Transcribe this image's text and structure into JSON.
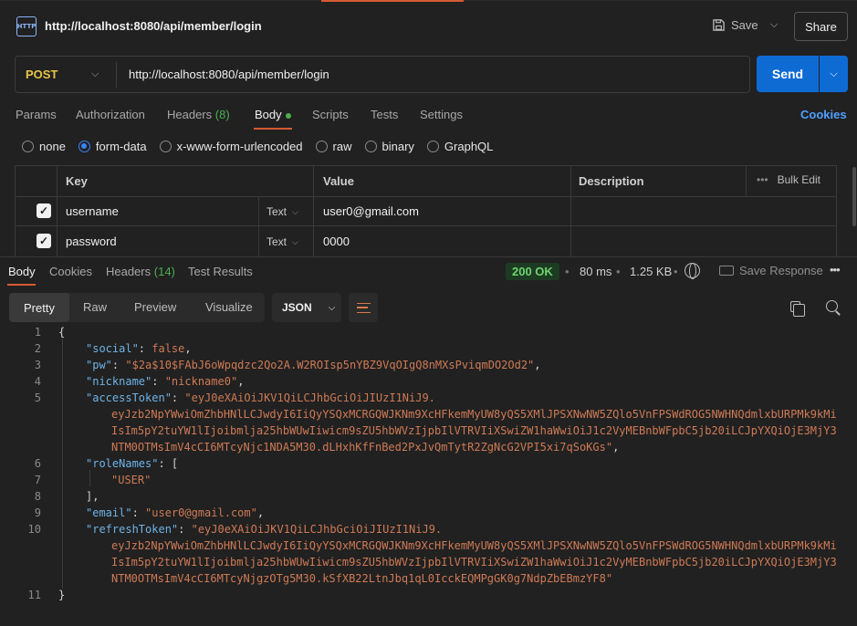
{
  "header": {
    "icon_text": "HTTP",
    "title": "http://localhost:8080/api/member/login",
    "save_label": "Save",
    "share_label": "Share"
  },
  "request": {
    "method": "POST",
    "url": "http://localhost:8080/api/member/login",
    "send_label": "Send",
    "tabs": [
      {
        "label": "Params"
      },
      {
        "label": "Authorization"
      },
      {
        "label": "Headers",
        "count": "(8)"
      },
      {
        "label": "Body"
      },
      {
        "label": "Scripts"
      },
      {
        "label": "Tests"
      },
      {
        "label": "Settings"
      }
    ],
    "cookies_label": "Cookies",
    "body_types": [
      "none",
      "form-data",
      "x-www-form-urlencoded",
      "raw",
      "binary",
      "GraphQL"
    ],
    "selected_body_type": "form-data",
    "table": {
      "headers": {
        "key": "Key",
        "value": "Value",
        "description": "Description",
        "bulk_edit": "Bulk Edit"
      },
      "rows": [
        {
          "checked": true,
          "key": "username",
          "type": "Text",
          "value": "user0@gmail.com",
          "description": ""
        },
        {
          "checked": true,
          "key": "password",
          "type": "Text",
          "value": "0000",
          "description": ""
        }
      ]
    }
  },
  "response": {
    "tabs": [
      {
        "label": "Body"
      },
      {
        "label": "Cookies"
      },
      {
        "label": "Headers",
        "count": "(14)"
      },
      {
        "label": "Test Results"
      }
    ],
    "status": "200 OK",
    "time": "80 ms",
    "size": "1.25 KB",
    "save_response_label": "Save Response",
    "views": [
      "Pretty",
      "Raw",
      "Preview",
      "Visualize"
    ],
    "format": "JSON",
    "line_numbers": [
      "1",
      "2",
      "3",
      "4",
      "5",
      "6",
      "7",
      "8",
      "9",
      "10",
      "11"
    ],
    "json": {
      "social": "false",
      "pw": "\"$2a$10$FAbJ6oWpqdzc2Qo2A.W2ROIsp5nYBZ9VqOIgQ8nMXsPviqmDO2Od2\"",
      "nickname": "\"nickname0\"",
      "accessToken_lines": [
        "\"eyJ0eXAiOiJKV1QiLCJhbGciOiJIUzI1NiJ9.",
        "eyJzb2NpYWwiOmZhbHNlLCJwdyI6IiQyYSQxMCRGQWJKNm9XcHFkemMyUW8yQS5XMlJPSXNwNW5ZQlo5VnFPSWdROG5NWHNQdmlxbURPMk9kMi",
        "IsIm5pY2tuYW1lIjoibmlja25hbWUwIiwicm9sZU5hbWVzIjpbIlVTRVIiXSwiZW1haWwiOiJ1c2VyMEBnbWFpbC5jb20iLCJpYXQiOjE3MjY3",
        "NTM0OTMsImV4cCI6MTcyNjc1NDA5M30.dLHxhKfFnBed2PxJvQmTytR2ZgNcG2VPI5xi7qSoKGs\""
      ],
      "roleNames_item": "\"USER\"",
      "email": "\"user0@gmail.com\"",
      "refreshToken_lines": [
        "\"eyJ0eXAiOiJKV1QiLCJhbGciOiJIUzI1NiJ9.",
        "eyJzb2NpYWwiOmZhbHNlLCJwdyI6IiQyYSQxMCRGQWJKNm9XcHFkemMyUW8yQS5XMlJPSXNwNW5ZQlo5VnFPSWdROG5NWHNQdmlxbURPMk9kMi",
        "IsIm5pY2tuYW1lIjoibmlja25hbWUwIiwicm9sZU5hbWVzIjpbIlVTRVIiXSwiZW1haWwiOiJ1c2VyMEBnbWFpbC5jb20iLCJpYXQiOjE3MjY3",
        "NTM0OTMsImV4cCI6MTcyNjgzOTg5M30.kSfXB22LtnJbq1qL0IcckEQMPgGK0g7NdpZbEBmzYF8\""
      ]
    }
  },
  "colors": {
    "accent": "#d65a31",
    "send": "#0f6bd4",
    "method": "#e8c547",
    "status": "#6fd36f",
    "json_key": "#6fb3e6",
    "json_string": "#ce7a55"
  }
}
